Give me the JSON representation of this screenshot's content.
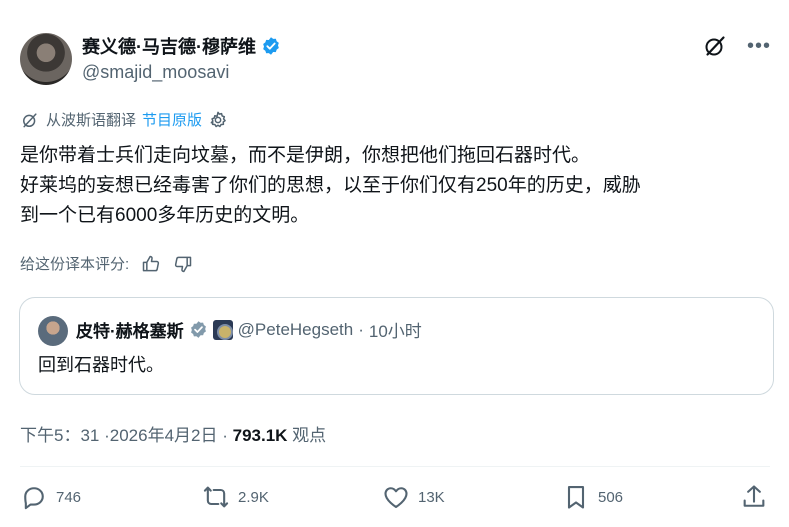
{
  "author": {
    "display_name": "赛义德·马吉德·穆萨维",
    "handle": "@smajid_moosavi"
  },
  "translation": {
    "source": "从波斯语翻译",
    "show_original": "节目原版"
  },
  "tweet": {
    "lines": [
      "是你带着士兵们走向坟墓，而不是伊朗，你想把他们拖回石器时代。",
      "好莱坞的妄想已经毒害了你们的思想，以至于你们仅有250年的历史，威胁",
      "到一个已有6000多年历史的文明。"
    ]
  },
  "rating": {
    "label": "给这份译本评分:"
  },
  "quote": {
    "name": "皮特·赫格塞斯",
    "handle": "@PeteHegseth",
    "separator": "·",
    "time": "10小时",
    "text": "回到石器时代。"
  },
  "meta": {
    "time": "下午5：31 ·2026年4月2日 ·",
    "views": "793.1K",
    "views_label": "观点"
  },
  "stats": {
    "replies": "746",
    "reposts": "2.9K",
    "likes": "13K",
    "bookmarks": "506"
  },
  "icons": [
    "verified-icon",
    "grok-icon",
    "more-icon",
    "translate-icon",
    "gear-icon",
    "thumbs-up-icon",
    "thumbs-down-icon",
    "reply-icon",
    "repost-icon",
    "like-icon",
    "bookmark-icon",
    "share-icon"
  ],
  "colors": {
    "accent": "#1d9bf0",
    "muted": "#536471",
    "text": "#0f1419",
    "border": "#cfd9de"
  }
}
